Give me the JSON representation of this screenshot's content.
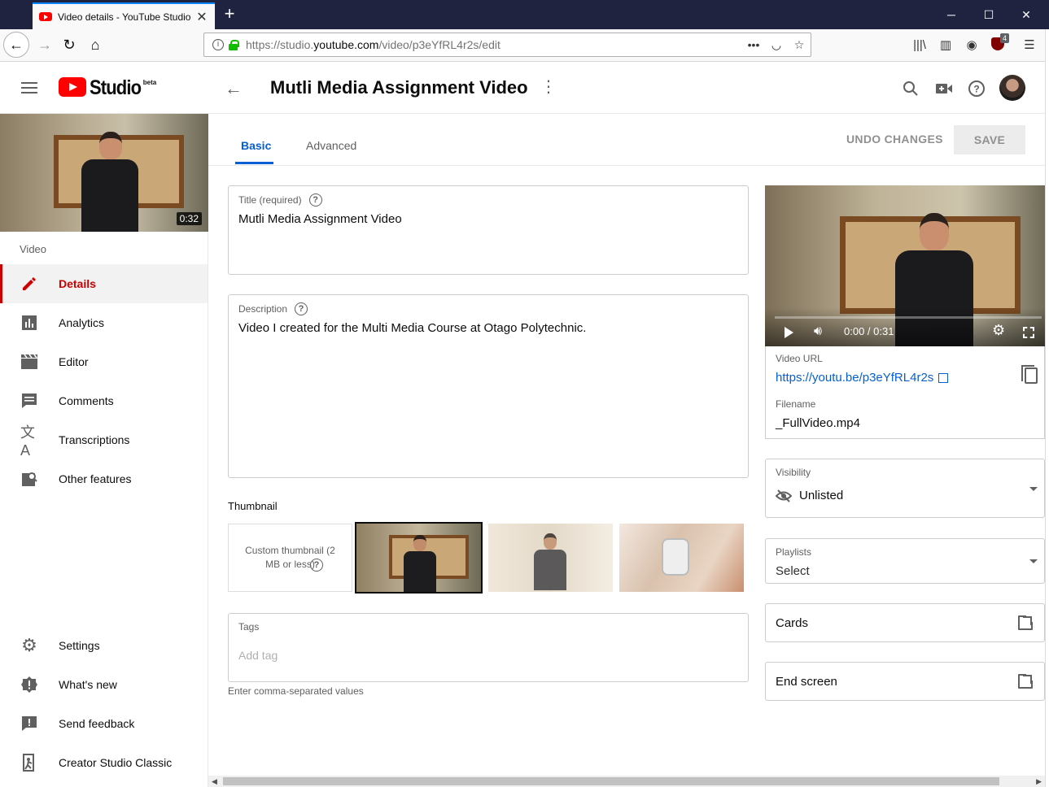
{
  "browser": {
    "tab_title": "Video details - YouTube Studio",
    "url_prefix": "https://studio.",
    "url_domain": "youtube.com",
    "url_path": "/video/p3eYfRL4r2s/edit",
    "extension_badge": "4"
  },
  "header": {
    "logo_text": "Studio",
    "logo_badge": "beta",
    "title": "Mutli Media Assignment Video"
  },
  "sidebar": {
    "duration": "0:32",
    "section_label": "Video",
    "items": [
      {
        "label": "Details",
        "icon": "pencil-icon",
        "active": true
      },
      {
        "label": "Analytics",
        "icon": "analytics-icon"
      },
      {
        "label": "Editor",
        "icon": "clapper-icon"
      },
      {
        "label": "Comments",
        "icon": "comment-icon"
      },
      {
        "label": "Transcriptions",
        "icon": "translate-icon"
      },
      {
        "label": "Other features",
        "icon": "other-features-icon"
      }
    ],
    "bottom_items": [
      {
        "label": "Settings",
        "icon": "gear-icon"
      },
      {
        "label": "What's new",
        "icon": "badge-alert-icon"
      },
      {
        "label": "Send feedback",
        "icon": "feedback-icon"
      },
      {
        "label": "Creator Studio Classic",
        "icon": "exit-icon"
      }
    ]
  },
  "tabs": {
    "basic": "Basic",
    "advanced": "Advanced"
  },
  "actions": {
    "undo": "UNDO CHANGES",
    "save": "SAVE"
  },
  "form": {
    "title_label": "Title (required)",
    "title_value": "Mutli Media Assignment Video",
    "description_label": "Description",
    "description_value": "Video I created for the Multi Media Course at Otago Polytechnic.",
    "thumbnail_label": "Thumbnail",
    "custom_thumbnail": "Custom thumbnail (2 MB or less)",
    "tags_label": "Tags",
    "tags_placeholder": "Add tag",
    "tags_hint": "Enter comma-separated values"
  },
  "player": {
    "time": "0:00 / 0:31",
    "progress": 0
  },
  "video_info": {
    "url_label": "Video URL",
    "url_value": "https://youtu.be/p3eYfRL4r2s",
    "filename_label": "Filename",
    "filename_value": "_FullVideo.mp4"
  },
  "visibility": {
    "label": "Visibility",
    "value": "Unlisted"
  },
  "playlists": {
    "label": "Playlists",
    "value": "Select"
  },
  "cards": {
    "label": "Cards"
  },
  "end_screen": {
    "label": "End screen"
  },
  "colors": {
    "accent": "#065fd4",
    "brand": "#ff0000",
    "active": "#cc0000"
  }
}
